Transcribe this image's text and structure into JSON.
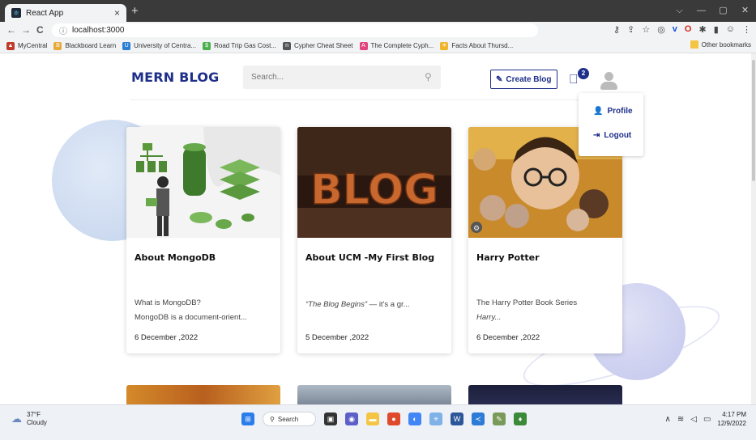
{
  "browser": {
    "tab_title": "React App",
    "tab_close": "×",
    "new_tab": "+",
    "url": "localhost:3000",
    "window_controls": [
      "⌵",
      "—",
      "▢",
      "✕"
    ],
    "nav": [
      "←",
      "→",
      "C"
    ],
    "bookmarks": [
      {
        "label": "MyCentral",
        "color": "#c0392b"
      },
      {
        "label": "Blackboard Learn",
        "color": "#e8a93b"
      },
      {
        "label": "University of Centra...",
        "color": "#2a7fd4"
      },
      {
        "label": "Road Trip Gas Cost...",
        "color": "#4caf50"
      },
      {
        "label": "Cypher Cheat Sheet",
        "color": "#555555"
      },
      {
        "label": "The Complete Cyph...",
        "color": "#e0457b"
      },
      {
        "label": "Facts About Thursd...",
        "color": "#f0b429"
      }
    ],
    "other_bookmarks": "Other bookmarks"
  },
  "header": {
    "logo": "MERN BLOG",
    "search_placeholder": "Search...",
    "create_button": "Create Blog",
    "notification_count": "2"
  },
  "menu": {
    "profile": "Profile",
    "logout": "Logout"
  },
  "posts": [
    {
      "title": "About MongoDB",
      "line1": "What is MongoDB?",
      "line2": "MongoDB is a document-orient...",
      "date": "6 December ,2022"
    },
    {
      "title": "About UCM -My First Blog",
      "line1": "“The Blog Begins”",
      "line1b": " — it's a gr...",
      "date": "5 December ,2022"
    },
    {
      "title": "Harry Potter",
      "line1": "The Harry Potter Book Series",
      "line2": "Harry...",
      "date": "6 December ,2022"
    }
  ],
  "taskbar": {
    "temp": "37°F",
    "weather": "Cloudy",
    "search": "Search",
    "time": "4:17 PM",
    "date": "12/9/2022"
  },
  "colors": {
    "brand": "#1e2f8a",
    "blog_bg": "#3a2418"
  }
}
